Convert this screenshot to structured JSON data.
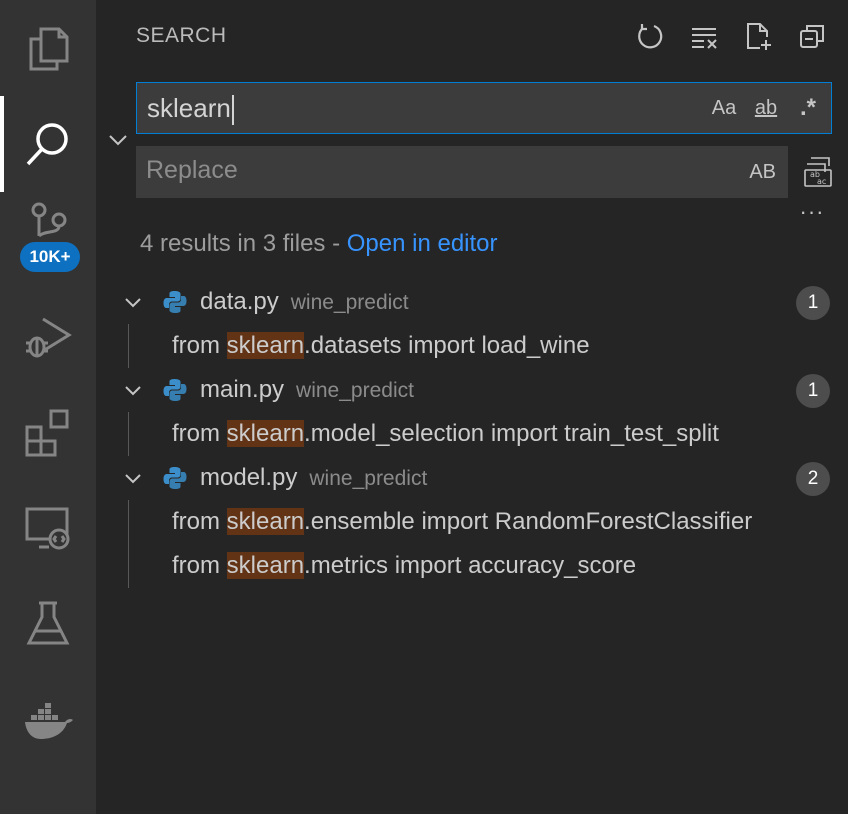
{
  "activity_bar": {
    "items": [
      {
        "name": "explorer",
        "icon": "files-icon"
      },
      {
        "name": "search",
        "icon": "search-icon",
        "active": true
      },
      {
        "name": "source-control",
        "icon": "source-control-icon",
        "badge": "10K+"
      },
      {
        "name": "run-debug",
        "icon": "debug-icon"
      },
      {
        "name": "extensions",
        "icon": "extensions-icon"
      },
      {
        "name": "remote-explorer",
        "icon": "remote-icon"
      },
      {
        "name": "testing",
        "icon": "flask-icon"
      },
      {
        "name": "docker",
        "icon": "docker-icon"
      }
    ],
    "badge_color": "#0e70c0",
    "active_indicator_color": "#ffffff"
  },
  "panel": {
    "title": "SEARCH",
    "actions": [
      "refresh-icon",
      "clear-results-icon",
      "new-search-editor-icon",
      "collapse-all-icon"
    ]
  },
  "search": {
    "query": "sklearn",
    "options": {
      "match_case": "Aa",
      "whole_word": "ab",
      "regex": ".*"
    },
    "border_color": "#007fd4"
  },
  "replace": {
    "placeholder": "Replace",
    "preserve_case": "AB",
    "more": "···"
  },
  "summary": {
    "text": "4 results in 3 files - ",
    "link": "Open in editor",
    "link_color": "#3794ff"
  },
  "results": [
    {
      "file": "data.py",
      "dir": "wine_predict",
      "count": "1",
      "matches": [
        {
          "before": "from ",
          "match": "sklearn",
          "after": ".datasets import load_wine"
        }
      ]
    },
    {
      "file": "main.py",
      "dir": "wine_predict",
      "count": "1",
      "matches": [
        {
          "before": "from ",
          "match": "sklearn",
          "after": ".model_selection import train_test_split"
        }
      ]
    },
    {
      "file": "model.py",
      "dir": "wine_predict",
      "count": "2",
      "matches": [
        {
          "before": "from ",
          "match": "sklearn",
          "after": ".ensemble import RandomForestClassifier"
        },
        {
          "before": "from ",
          "match": "sklearn",
          "after": ".metrics import accuracy_score"
        }
      ]
    }
  ],
  "colors": {
    "highlight": "#623315",
    "python_icon": "#3b8ec9"
  }
}
